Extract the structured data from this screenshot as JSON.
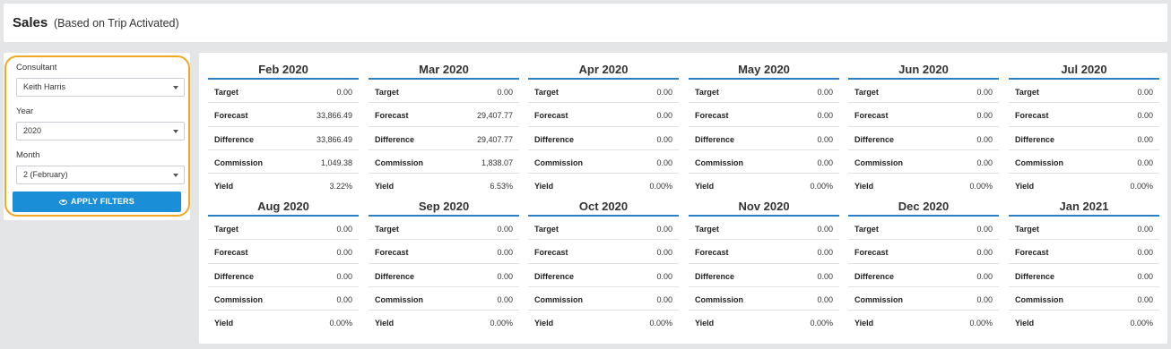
{
  "header": {
    "title": "Sales",
    "subtitle": "(Based on Trip Activated)"
  },
  "filters": {
    "consultant_label": "Consultant",
    "consultant_value": "Keith Harris",
    "year_label": "Year",
    "year_value": "2020",
    "month_label": "Month",
    "month_value": "2 (February)",
    "apply_label": "APPLY FILTERS",
    "highlight_color": "#f0a823",
    "button_color": "#1a8fd8"
  },
  "row_labels": [
    "Target",
    "Forecast",
    "Difference",
    "Commission",
    "Yield"
  ],
  "months": [
    {
      "title": "Feb 2020",
      "values": [
        "0.00",
        "33,866.49",
        "33,866.49",
        "1,049.38",
        "3.22%"
      ]
    },
    {
      "title": "Mar 2020",
      "values": [
        "0.00",
        "29,407.77",
        "29,407.77",
        "1,838.07",
        "6.53%"
      ]
    },
    {
      "title": "Apr 2020",
      "values": [
        "0.00",
        "0.00",
        "0.00",
        "0.00",
        "0.00%"
      ]
    },
    {
      "title": "May 2020",
      "values": [
        "0.00",
        "0.00",
        "0.00",
        "0.00",
        "0.00%"
      ]
    },
    {
      "title": "Jun 2020",
      "values": [
        "0.00",
        "0.00",
        "0.00",
        "0.00",
        "0.00%"
      ]
    },
    {
      "title": "Jul 2020",
      "values": [
        "0.00",
        "0.00",
        "0.00",
        "0.00",
        "0.00%"
      ]
    },
    {
      "title": "Aug 2020",
      "values": [
        "0.00",
        "0.00",
        "0.00",
        "0.00",
        "0.00%"
      ]
    },
    {
      "title": "Sep 2020",
      "values": [
        "0.00",
        "0.00",
        "0.00",
        "0.00",
        "0.00%"
      ]
    },
    {
      "title": "Oct 2020",
      "values": [
        "0.00",
        "0.00",
        "0.00",
        "0.00",
        "0.00%"
      ]
    },
    {
      "title": "Nov 2020",
      "values": [
        "0.00",
        "0.00",
        "0.00",
        "0.00",
        "0.00%"
      ]
    },
    {
      "title": "Dec 2020",
      "values": [
        "0.00",
        "0.00",
        "0.00",
        "0.00",
        "0.00%"
      ]
    },
    {
      "title": "Jan 2021",
      "values": [
        "0.00",
        "0.00",
        "0.00",
        "0.00",
        "0.00%"
      ]
    }
  ]
}
